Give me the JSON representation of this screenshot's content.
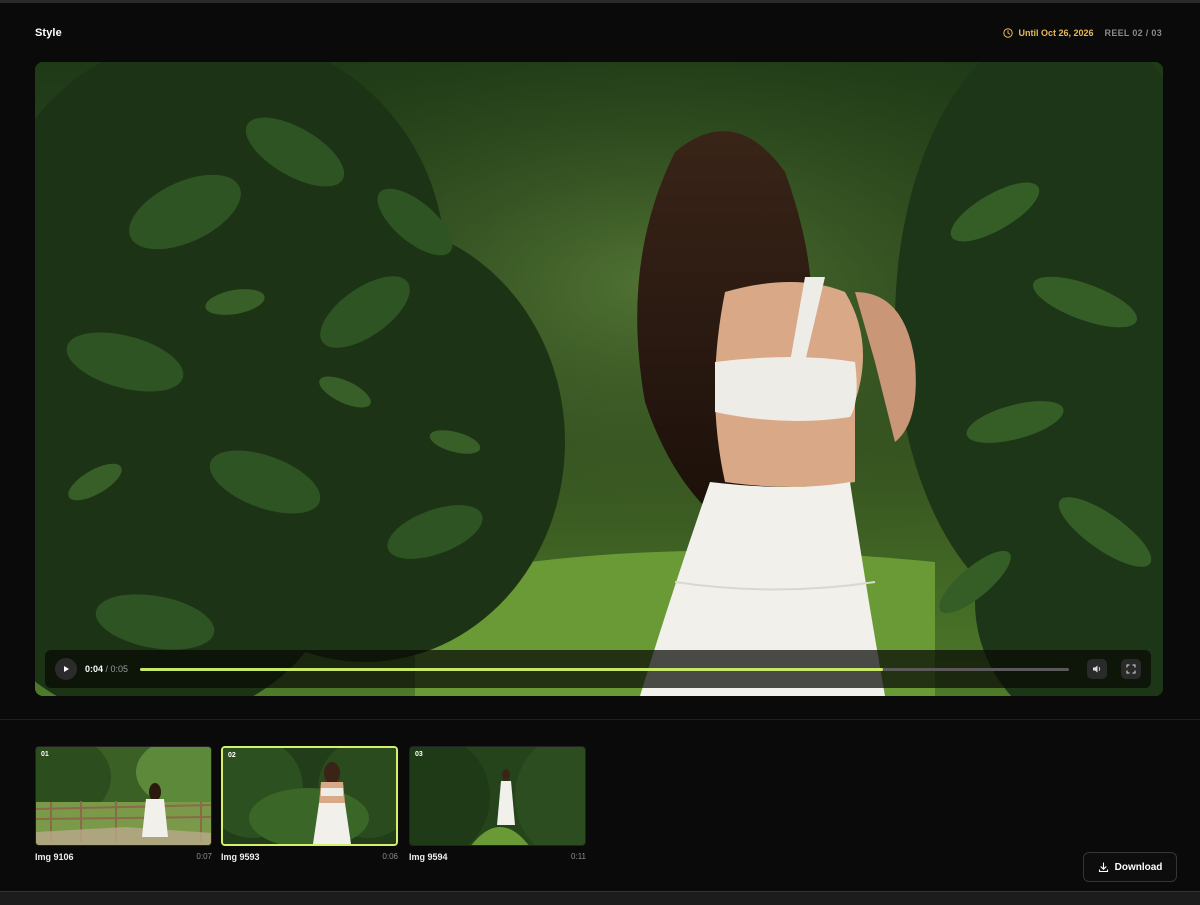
{
  "header": {
    "title": "Style",
    "expiry": "Until Oct 26, 2026",
    "reel_position": "REEL 02 / 03",
    "expiry_color": "#e8b85a"
  },
  "player": {
    "current_time": "0:04",
    "duration": "/ 0:05",
    "progress_fraction": 0.8,
    "accent_color": "#c8e86a",
    "icons": [
      "play-icon",
      "volume-icon",
      "fullscreen-icon"
    ]
  },
  "reel": {
    "items": [
      {
        "number": "01",
        "name": "Img 9106",
        "duration": "0:07",
        "active": false
      },
      {
        "number": "02",
        "name": "Img 9593",
        "duration": "0:06",
        "active": true
      },
      {
        "number": "03",
        "name": "Img 9594",
        "duration": "0:11",
        "active": false
      }
    ]
  },
  "actions": {
    "download_label": "Download"
  }
}
